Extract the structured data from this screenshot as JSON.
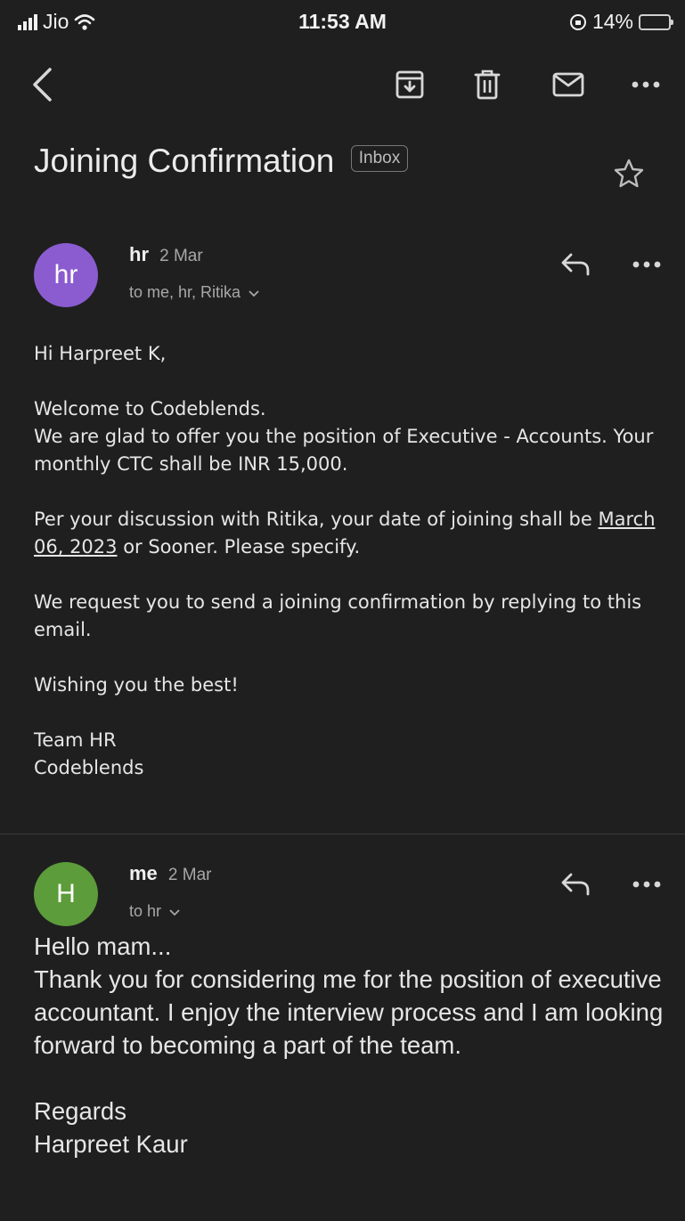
{
  "status_bar": {
    "carrier": "Jio",
    "time": "11:53 AM",
    "battery_percent": "14%",
    "battery_level": 0.14
  },
  "toolbar": {
    "back_icon": "chevron-left-icon",
    "archive_icon": "archive-icon",
    "delete_icon": "trash-icon",
    "mark_unread_icon": "mail-icon",
    "more_icon": "more-horizontal-icon"
  },
  "thread": {
    "subject": "Joining Confirmation",
    "label": "Inbox",
    "starred": false
  },
  "messages": [
    {
      "avatar_text": "hr",
      "avatar_color": "#8a5cd0",
      "sender": "hr",
      "date": "2 Mar",
      "recipients": "to me, hr, Ritika",
      "body": {
        "greeting": "Hi Harpreet K,",
        "line1": "Welcome to Codeblends.",
        "line2": "We are glad to offer you the position of Executive - Accounts. Your monthly CTC shall be INR 15,000.",
        "line3_prefix": "Per your discussion with Ritika, your date of joining shall be ",
        "line3_date": "March 06, 2023",
        "line3_suffix": " or Sooner. Please specify.",
        "line4": "We request you to send a joining confirmation by replying to this email.",
        "line5": "Wishing you the best!",
        "sign1": "Team HR",
        "sign2": "Codeblends"
      }
    },
    {
      "avatar_text": "H",
      "avatar_color": "#5c9c3a",
      "sender": "me",
      "date": "2 Mar",
      "recipients": "to hr",
      "body": {
        "line1": "Hello mam...",
        "line2": "Thank you for considering me for the position of executive accountant. I  enjoy the interview process and I am looking forward to becoming a part of the team.",
        "sign1": "Regards",
        "sign2": "Harpreet Kaur"
      }
    }
  ]
}
